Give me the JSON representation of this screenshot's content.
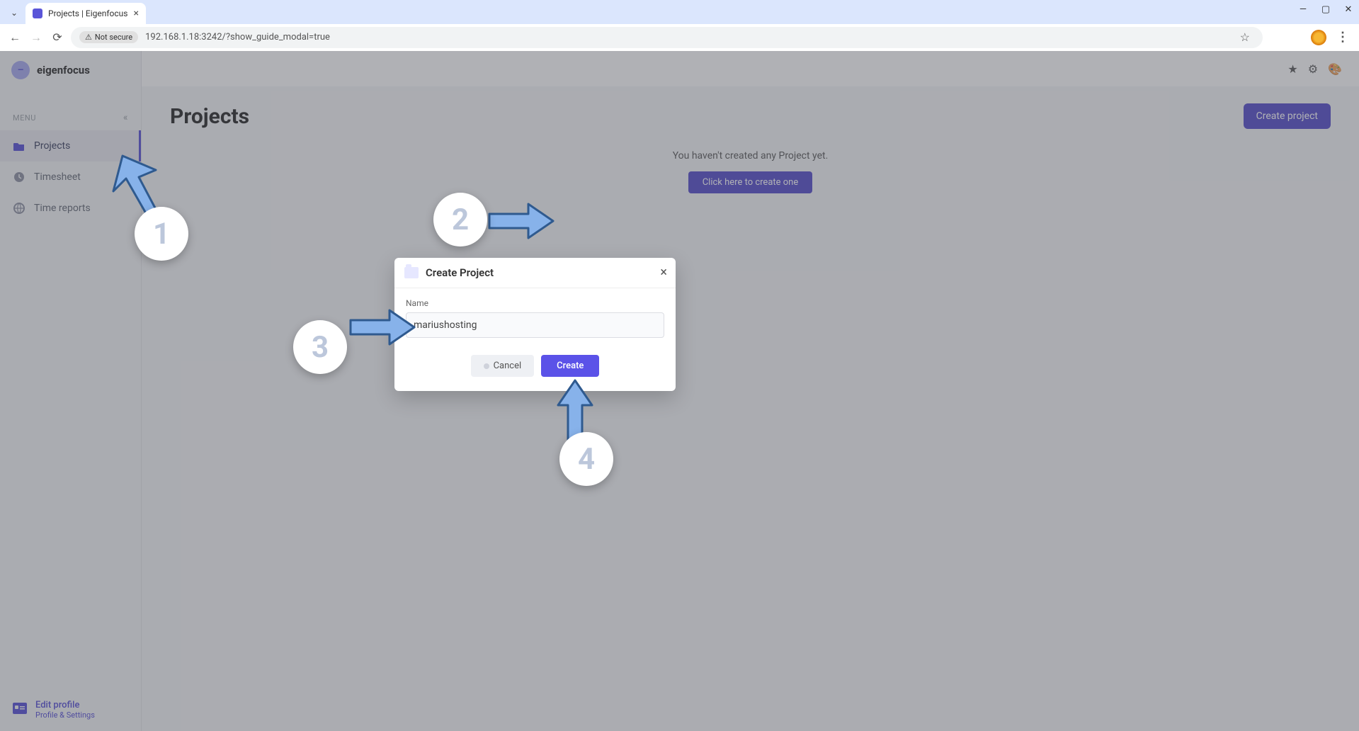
{
  "browser": {
    "tab_title": "Projects | Eigenfocus",
    "security_label": "Not secure",
    "url": "192.168.1.18:3242/?show_guide_modal=true"
  },
  "sidebar": {
    "brand": "eigenfocus",
    "menu_label": "MENU",
    "items": [
      {
        "label": "Projects",
        "icon": "folder-icon"
      },
      {
        "label": "Timesheet",
        "icon": "clock-icon"
      },
      {
        "label": "Time reports",
        "icon": "globe-icon"
      }
    ],
    "footer": {
      "title": "Edit profile",
      "subtitle": "Profile & Settings"
    }
  },
  "header": {
    "icons": [
      "star-icon",
      "gear-icon",
      "palette-icon"
    ]
  },
  "page": {
    "title": "Projects",
    "create_button": "Create project",
    "empty_text": "You haven't created any Project yet.",
    "cta_button": "Click here to create one"
  },
  "modal": {
    "title": "Create Project",
    "name_label": "Name",
    "name_value": "mariushosting",
    "cancel": "Cancel",
    "submit": "Create"
  },
  "annotations": {
    "b1": "1",
    "b2": "2",
    "b3": "3",
    "b4": "4"
  },
  "colors": {
    "primary": "#5149d6",
    "primary_dark": "#4f46c8",
    "arrow": "#87b2ea",
    "arrow_stroke": "#2f5a8f"
  }
}
